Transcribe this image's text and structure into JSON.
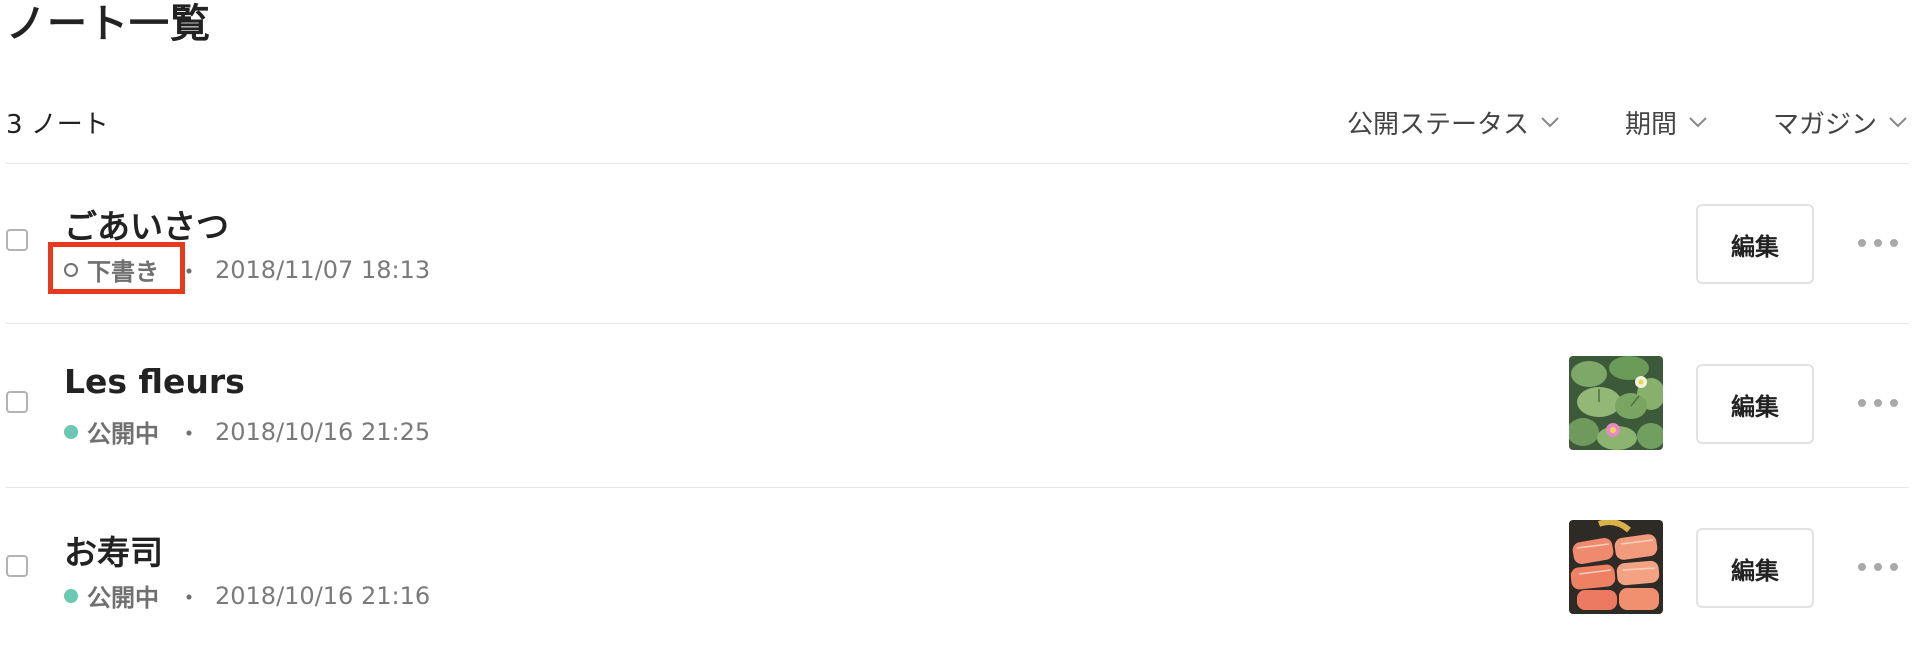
{
  "page": {
    "title": "ノート一覧"
  },
  "toolbar": {
    "count_label": "3 ノート",
    "filters": [
      {
        "label": "公開ステータス",
        "icon": "chevron-down-icon"
      },
      {
        "label": "期間",
        "icon": "chevron-down-icon"
      },
      {
        "label": "マガジン",
        "icon": "chevron-down-icon"
      }
    ]
  },
  "notes": [
    {
      "title": "ごあいさつ",
      "status": "下書き",
      "status_type": "draft",
      "separator": "・",
      "date": "2018/11/07 18:13",
      "has_thumbnail": false,
      "edit_label": "編集",
      "more_icon": "more-dots-icon",
      "highlighted": true
    },
    {
      "title": "Les fleurs",
      "status": "公開中",
      "status_type": "published",
      "separator": "・",
      "date": "2018/10/16 21:25",
      "has_thumbnail": true,
      "thumbnail": "lily-pads-thumbnail",
      "edit_label": "編集",
      "more_icon": "more-dots-icon",
      "highlighted": false
    },
    {
      "title": "お寿司",
      "status": "公開中",
      "status_type": "published",
      "separator": "・",
      "date": "2018/10/16 21:16",
      "has_thumbnail": true,
      "thumbnail": "sushi-thumbnail",
      "edit_label": "編集",
      "more_icon": "more-dots-icon",
      "highlighted": false
    }
  ],
  "colors": {
    "published_dot": "#6cc9b0",
    "draft_dot_border": "#707070",
    "highlight_border": "#e8391d",
    "divider": "#e6e6e6"
  }
}
